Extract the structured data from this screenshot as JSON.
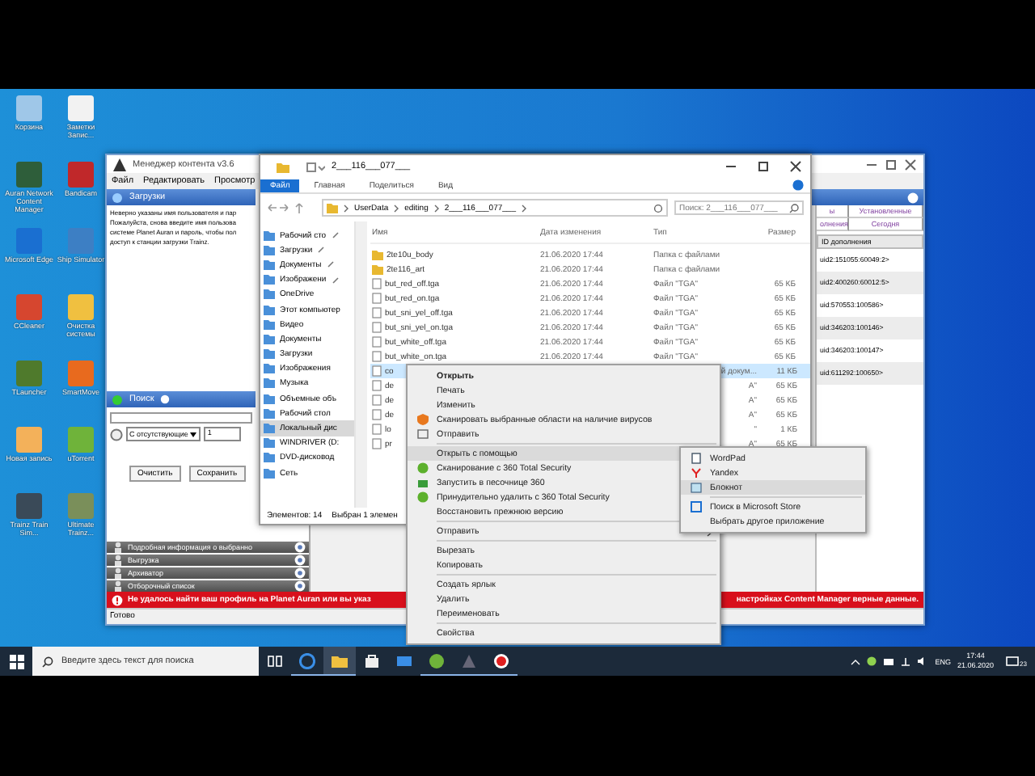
{
  "desktop_icons": [
    {
      "label": "Корзина",
      "color": "#9fc7e8"
    },
    {
      "label": "Заметки Запис...",
      "color": "#f2f2f2"
    },
    {
      "label": "Auran Network Content Manager",
      "color": "#2e5e3a"
    },
    {
      "label": "Bandicam",
      "color": "#c0282a"
    },
    {
      "label": "Microsoft Edge",
      "color": "#1a6fd1"
    },
    {
      "label": "Ship Simulator",
      "color": "#3d7fc4"
    },
    {
      "label": "CCleaner",
      "color": "#d6462f"
    },
    {
      "label": "Очистка системы",
      "color": "#f0c040"
    },
    {
      "label": "TLauncher",
      "color": "#4f7a2c"
    },
    {
      "label": "SmartMove",
      "color": "#e86a1e"
    },
    {
      "label": "Новая запись",
      "color": "#f3b15a"
    },
    {
      "label": "uTorrent",
      "color": "#6fb33a"
    },
    {
      "label": "Trainz Train Sim...",
      "color": "#3a4a58"
    },
    {
      "label": "Ultimate Trainz...",
      "color": "#7a8f5a"
    }
  ],
  "content_manager": {
    "title": "Менеджер контента v3.6",
    "menu": [
      "Файл",
      "Редактировать",
      "Просмотр"
    ],
    "downloads_title": "Загрузки",
    "message_lines": [
      "Неверно указаны имя пользователя и пар",
      "Пожалуйста, снова введите имя пользова",
      "системе Planet Auran и пароль, чтобы пол",
      "доступ к станции загрузки Trainz."
    ],
    "search_title": "Поиск",
    "filter": "С отсутствующие",
    "filter_value": "1",
    "buttons": [
      "Очистить",
      "Сохранить"
    ],
    "sections": [
      "Подробная информация о выбранно",
      "Выгрузка",
      "Архиватор",
      "Отборочный список"
    ],
    "tabs": [
      {
        "label": "ы",
        "selected": false
      },
      {
        "label": "Установленные",
        "selected": false
      },
      {
        "label": "олнения",
        "selected": false
      },
      {
        "label": "Сегодня",
        "selected": false
      }
    ],
    "column": "ID дополнения",
    "rows": [
      "uid2:151055:60049:2>",
      "uid2:400260:60012:5>",
      "uid:570553:100586>",
      "uid:346203:100146>",
      "uid:346203:100147>",
      "uid:611292:100650>"
    ],
    "error_left": "Не удалось найти ваш профиль на Planet Auran или вы указ",
    "error_right": "настройках Content Manager верные данные.",
    "status": "Готово"
  },
  "explorer": {
    "title": "2___116___077___",
    "ribbon": [
      {
        "label": "Файл",
        "selected": true
      },
      {
        "label": "Главная",
        "selected": false
      },
      {
        "label": "Поделиться",
        "selected": false
      },
      {
        "label": "Вид",
        "selected": false
      }
    ],
    "path": [
      "UserData",
      "editing",
      "2___116___077___"
    ],
    "search": {
      "placeholder": "Поиск: 2___116___077___"
    },
    "nav": [
      {
        "label": "Рабочий сто",
        "pinned": true,
        "selected": false
      },
      {
        "label": "Загрузки",
        "pinned": true,
        "selected": false
      },
      {
        "label": "Документы",
        "pinned": true,
        "selected": false
      },
      {
        "label": "Изображени",
        "pinned": true,
        "selected": false
      },
      {
        "label": "OneDrive",
        "pinned": false,
        "selected": false
      },
      {
        "label": "Этот компьютер",
        "pinned": false,
        "selected": false,
        "children": [
          {
            "label": "Видео",
            "pinned": false,
            "selected": false
          },
          {
            "label": "Документы",
            "pinned": false,
            "selected": false
          },
          {
            "label": "Загрузки",
            "pinned": false,
            "selected": false
          },
          {
            "label": "Изображения",
            "pinned": false,
            "selected": false
          },
          {
            "label": "Музыка",
            "pinned": false,
            "selected": false
          },
          {
            "label": "Объемные объ",
            "pinned": false,
            "selected": false
          },
          {
            "label": "Рабочий стол",
            "pinned": false,
            "selected": false
          },
          {
            "label": "Локальный дис",
            "pinned": false,
            "selected": true
          },
          {
            "label": "WINDRIVER (D:",
            "pinned": false,
            "selected": false
          },
          {
            "label": "DVD-дисковод",
            "pinned": false,
            "selected": false
          }
        ]
      },
      {
        "label": "Сеть",
        "pinned": false,
        "selected": false
      }
    ],
    "columns": [
      "Имя",
      "Дата изменения",
      "Тип",
      "Размер"
    ],
    "files": [
      {
        "kind": "folder",
        "name": "2te10u_body",
        "date": "21.06.2020 17:44",
        "type": "Папка с файлами",
        "selected": false
      },
      {
        "kind": "folder",
        "name": "2te116_art",
        "date": "21.06.2020 17:44",
        "type": "Папка с файлами",
        "selected": false
      },
      {
        "kind": "file",
        "name": "but_red_off.tga",
        "date": "21.06.2020 17:44",
        "type": "Файл \"TGA\"",
        "size": "65 КБ",
        "selected": false
      },
      {
        "kind": "file",
        "name": "but_red_on.tga",
        "date": "21.06.2020 17:44",
        "type": "Файл \"TGA\"",
        "size": "65 КБ",
        "selected": false
      },
      {
        "kind": "file",
        "name": "but_sni_yel_off.tga",
        "date": "21.06.2020 17:44",
        "type": "Файл \"TGA\"",
        "size": "65 КБ",
        "selected": false
      },
      {
        "kind": "file",
        "name": "but_sni_yel_on.tga",
        "date": "21.06.2020 17:44",
        "type": "Файл \"TGA\"",
        "size": "65 КБ",
        "selected": false
      },
      {
        "kind": "file",
        "name": "but_white_off.tga",
        "date": "21.06.2020 17:44",
        "type": "Файл \"TGA\"",
        "size": "65 КБ",
        "selected": false
      },
      {
        "kind": "file",
        "name": "but_white_on.tga",
        "date": "21.06.2020 17:44",
        "type": "Файл \"TGA\"",
        "size": "65 КБ",
        "selected": false
      },
      {
        "kind": "file",
        "name": "co",
        "type_tail": "й докум...",
        "size": "11 КБ",
        "selected": true
      },
      {
        "kind": "file",
        "name": "de",
        "type_tail": "А\"",
        "size": "65 КБ",
        "selected": false
      },
      {
        "kind": "file",
        "name": "de",
        "type_tail": "А\"",
        "size": "65 КБ",
        "selected": false
      },
      {
        "kind": "file",
        "name": "de",
        "type_tail": "А\"",
        "size": "65 КБ",
        "selected": false
      },
      {
        "kind": "file",
        "name": "lo",
        "type_tail": "\"",
        "size": "1 КБ",
        "selected": false
      },
      {
        "kind": "file",
        "name": "pr",
        "type_tail": "А\"",
        "size": "65 КБ",
        "selected": false
      }
    ],
    "count": "Элементов: 14",
    "selection": "Выбран 1 элемен"
  },
  "context_menu": [
    {
      "kind": "bold",
      "label": "Открыть"
    },
    {
      "kind": "plain",
      "label": "Печать"
    },
    {
      "kind": "plain",
      "label": "Изменить"
    },
    {
      "kind": "scan",
      "label": "Сканировать выбранные области на наличие вирусов"
    },
    {
      "kind": "send",
      "label": "Отправить"
    },
    {
      "kind": "separator"
    },
    {
      "kind": "submenu",
      "label": "Открыть с помощью",
      "selected": true
    },
    {
      "kind": "total360",
      "label": "Сканирование с 360 Total Security"
    },
    {
      "kind": "sandbox",
      "label": "Запустить в песочнице 360"
    },
    {
      "kind": "total360",
      "label": "Принудительно удалить с  360 Total Security"
    },
    {
      "kind": "plain",
      "label": "Восстановить прежнюю версию"
    },
    {
      "kind": "separator"
    },
    {
      "kind": "submenu",
      "label": "Отправить",
      "selected": false
    },
    {
      "kind": "separator"
    },
    {
      "kind": "plain",
      "label": "Вырезать"
    },
    {
      "kind": "plain",
      "label": "Копировать"
    },
    {
      "kind": "separator"
    },
    {
      "kind": "plain",
      "label": "Создать ярлык"
    },
    {
      "kind": "plain",
      "label": "Удалить"
    },
    {
      "kind": "plain",
      "label": "Переименовать"
    },
    {
      "kind": "separator"
    },
    {
      "kind": "plain",
      "label": "Свойства"
    }
  ],
  "open_with_menu": [
    {
      "kind": "wordpad",
      "label": "WordPad",
      "selected": false
    },
    {
      "kind": "yandex",
      "label": "Yandex",
      "selected": false
    },
    {
      "kind": "notepad",
      "label": "Блокнот",
      "selected": true
    },
    {
      "kind": "separator"
    },
    {
      "kind": "store",
      "label": "Поиск в Microsoft Store",
      "selected": false
    },
    {
      "kind": "plain",
      "label": "Выбрать другое приложение",
      "selected": false
    }
  ],
  "taskbar": {
    "search": {
      "placeholder": "Введите здесь текст для поиска"
    },
    "apps": [
      {
        "kind": "taskview",
        "open": false,
        "selected": false
      },
      {
        "kind": "edge",
        "open": true,
        "selected": false
      },
      {
        "kind": "explorer",
        "open": true,
        "selected": true
      },
      {
        "kind": "store",
        "open": false,
        "selected": false
      },
      {
        "kind": "mail",
        "open": false,
        "selected": false
      },
      {
        "kind": "utorrent",
        "open": true,
        "selected": false
      },
      {
        "kind": "trainz",
        "open": true,
        "selected": false
      },
      {
        "kind": "record",
        "open": true,
        "selected": false
      }
    ],
    "language": "ENG",
    "time": "17:44",
    "date": "21.06.2020",
    "notifications": "23"
  }
}
